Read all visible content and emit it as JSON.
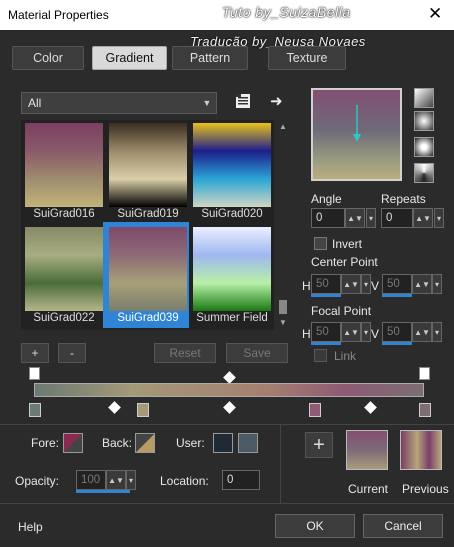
{
  "window": {
    "title": "Material Properties",
    "watermark_top": "Tuto by_SuizaBella",
    "watermark_sub": "Tradução by_Neusa Novaes"
  },
  "tabs": [
    {
      "label": "Color",
      "active": false
    },
    {
      "label": "Gradient",
      "active": true
    },
    {
      "label": "Pattern",
      "active": false
    },
    {
      "label": "Texture",
      "active": false
    }
  ],
  "filter": {
    "value": "All"
  },
  "swatches": [
    {
      "label": "SuiGrad016",
      "colors": [
        "#7a3f62",
        "#8a5a6a",
        "#9e8c6e",
        "#c2b47a"
      ]
    },
    {
      "label": "SuiGrad019",
      "colors": [
        "#3a2e22",
        "#9c8a6a",
        "#d9cfa8",
        "#000000"
      ]
    },
    {
      "label": "SuiGrad020",
      "colors": [
        "#e7c31b",
        "#1d1d8c",
        "#2aa5d6",
        "#cfd6c4"
      ]
    },
    {
      "label": "SuiGrad022",
      "colors": [
        "#888a64",
        "#a8ad80",
        "#4a6c3a",
        "#b6b68a"
      ]
    },
    {
      "label": "SuiGrad039",
      "colors": [
        "#7e4a6c",
        "#8d6a76",
        "#a7a078",
        "#7a7e6e"
      ],
      "selected": true
    },
    {
      "label": "Summer Field",
      "colors": [
        "#eaf0ff",
        "#9fb6f0",
        "#b8f0a8",
        "#1a7a14"
      ]
    }
  ],
  "list_buttons": {
    "add": "+",
    "remove": "-",
    "reset": "Reset",
    "save": "Save"
  },
  "angle": {
    "label": "Angle",
    "value": "0"
  },
  "repeats": {
    "label": "Repeats",
    "value": "0"
  },
  "invert": {
    "label": "Invert",
    "checked": false
  },
  "center_point": {
    "label": "Center Point",
    "h_label": "H",
    "h": "50",
    "v_label": "V",
    "v": "50"
  },
  "focal_point": {
    "label": "Focal Point",
    "h_label": "H",
    "h": "50",
    "v_label": "V",
    "v": "50"
  },
  "link": {
    "label": "Link",
    "checked": false
  },
  "fore_label": "Fore:",
  "back_label": "Back:",
  "user_label": "User:",
  "opacity": {
    "label": "Opacity:",
    "value": "100"
  },
  "location": {
    "label": "Location:",
    "value": "0"
  },
  "current_label": "Current",
  "previous_label": "Previous",
  "footer": {
    "help": "Help",
    "ok": "OK",
    "cancel": "Cancel"
  },
  "colors": {
    "accent": "#2f84d6",
    "fore": "#8a2a52",
    "back": "#b89a66"
  },
  "icons": [
    "close-icon",
    "list-menu-icon",
    "arrow-right-icon",
    "spin-up-down-icon",
    "dropdown-arrow-icon",
    "add-plus-icon"
  ]
}
